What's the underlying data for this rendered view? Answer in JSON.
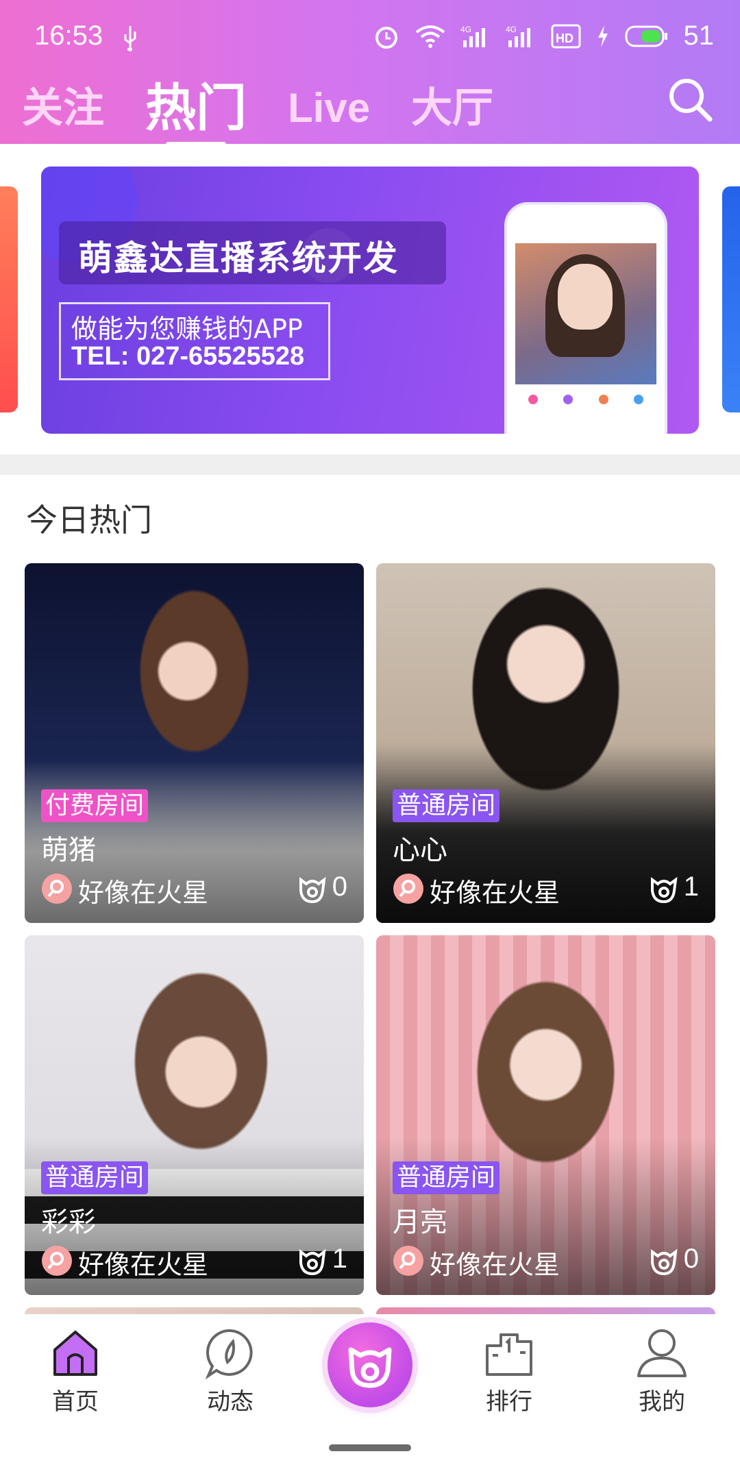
{
  "status": {
    "time": "16:53",
    "battery": "51"
  },
  "tabs": [
    "关注",
    "热门",
    "Live",
    "大厅"
  ],
  "banner": {
    "title": "萌鑫达直播系统开发",
    "slogan": "做能为您赚钱的APP",
    "tel": "TEL: 027-65525528"
  },
  "section_title": "今日热门",
  "rooms": [
    {
      "type": "付费房间",
      "name": "萌猪",
      "location": "好像在火星",
      "viewers": "0"
    },
    {
      "type": "普通房间",
      "name": "心心",
      "location": "好像在火星",
      "viewers": "1"
    },
    {
      "type": "普通房间",
      "name": "彩彩",
      "location": "好像在火星",
      "viewers": "1"
    },
    {
      "type": "普通房间",
      "name": "月亮",
      "location": "好像在火星",
      "viewers": "0"
    }
  ],
  "nav": [
    "首页",
    "动态",
    "排行",
    "我的"
  ],
  "colors": {
    "accent_pink": "#ee52c7",
    "accent_purple": "#8a55f0"
  }
}
